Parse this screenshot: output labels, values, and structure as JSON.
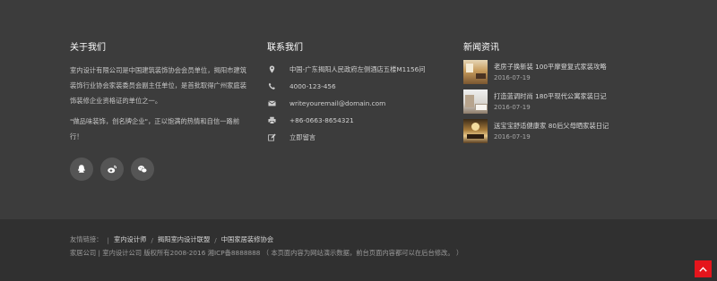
{
  "about": {
    "title": "关于我们",
    "paragraph1": "室内设计有限公司是中国建筑装饰协会会员单位，揭阳市建筑装饰行业协会家装委员会副主任单位，是首批取得广州家庭装饰装修企业资格证的单位之一。",
    "paragraph2": "\"做品味装饰，创名牌企业\"，正以饱满的热情和自信一路前行！",
    "social": [
      {
        "icon": "qq-icon"
      },
      {
        "icon": "weibo-icon"
      },
      {
        "icon": "wechat-icon"
      }
    ]
  },
  "contact": {
    "title": "联系我们",
    "address": "中国-广东揭阳人民政府左侧酒店五楼M1156问",
    "phone": "4000-123-456",
    "email": "writeyouremail@domain.com",
    "fax": "+86-0663-8654321",
    "message": "立即留言"
  },
  "news": {
    "title": "新闻资讯",
    "items": [
      {
        "title": "老房子换新装 100平摩登复式家装攻略",
        "date": "2016-07-19"
      },
      {
        "title": "打造蓝调时尚 180平现代公寓家装日记",
        "date": "2016-07-19"
      },
      {
        "title": "送宝宝舒适健康家 80后父母晒家装日记",
        "date": "2016-07-19"
      }
    ]
  },
  "bottom": {
    "links_label": "友情链接：",
    "links": [
      "室内设计师",
      "揭阳室内设计联盟",
      "中国家居装修协会"
    ],
    "copyright": "家居公司 | 室内设计公司 版权所有2008-2016 湘ICP备8888888 （ 本页面内容为网站演示数据，前台页面内容都可以在后台修改。 ）"
  },
  "colors": {
    "accent": "#e5151c",
    "background": "#3c3c3c",
    "bottom_background": "#303030"
  }
}
